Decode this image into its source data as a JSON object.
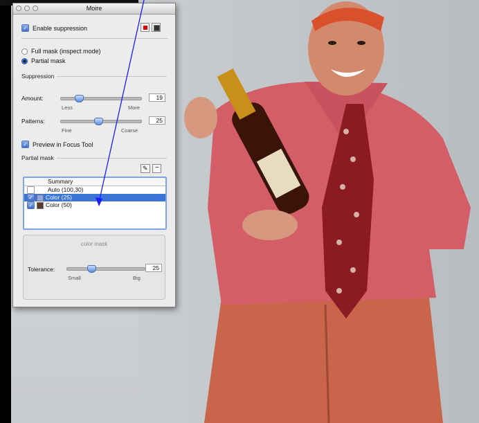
{
  "window": {
    "title": "Moire"
  },
  "controls": {
    "enable_suppression": "Enable suppression",
    "full_mask": "Full mask (inspect mode)",
    "partial_mask": "Partial mask",
    "suppression_header": "Suppression",
    "amount_label": "Amount:",
    "amount_value": "19",
    "amount_low": "Less",
    "amount_high": "More",
    "patterns_label": "Patterns:",
    "patterns_value": "25",
    "patterns_low": "Fine",
    "patterns_high": "Coarse",
    "preview_focus": "Preview in Focus Tool",
    "partial_mask_header": "Partial mask"
  },
  "mask_list": {
    "header": "Summary",
    "rows": [
      {
        "label": "Auto (100,30)",
        "checked": false,
        "selected": false,
        "swatch": ""
      },
      {
        "label": "Color (25)",
        "checked": true,
        "selected": true,
        "swatch": "#8fa6e0"
      },
      {
        "label": "Color (50)",
        "checked": true,
        "selected": false,
        "swatch": "#5a3a33"
      }
    ]
  },
  "color_mask": {
    "title": "color mask",
    "tolerance_label": "Tolerance:",
    "tolerance_value": "25",
    "tolerance_low": "Small",
    "tolerance_high": "Big"
  },
  "colors": {
    "accent": "#3a74d6",
    "red_button": "#e00000",
    "arrow": "#1a1aff"
  },
  "sliders": {
    "amount": 0.22,
    "patterns": 0.46,
    "tolerance": 0.31
  }
}
